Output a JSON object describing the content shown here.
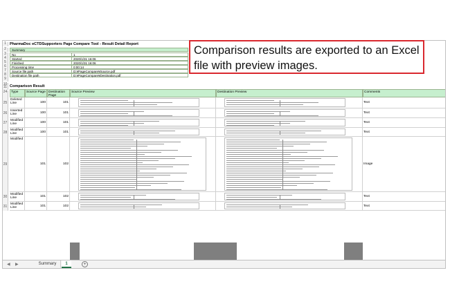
{
  "report": {
    "title": "PharmaDoc eCTDSupporters Page Compare Tool - Result Detail Report",
    "summary_header": "Summary",
    "summary_rows": [
      {
        "key": "No",
        "value": "1"
      },
      {
        "key": "Started",
        "value": "2020/1/31 16:06"
      },
      {
        "key": "Finished",
        "value": "2020/1/31 16:06"
      },
      {
        "key": "Processing time",
        "value": "0:00:14"
      },
      {
        "key": "Source file path",
        "value": "D:¥PageCompare¥Source.pdf"
      },
      {
        "key": "Destination file path",
        "value": "D:¥PageCompare¥Destination.pdf"
      }
    ],
    "result_title": "Comparison Result",
    "columns": [
      "Type",
      "Source Page",
      "Destination Page",
      "Source Preview",
      "Destination Preview",
      "Comments"
    ],
    "rows": [
      {
        "num": "25",
        "type": "Deleted Line",
        "src": "100",
        "dst": "101",
        "comment": "Text"
      },
      {
        "num": "26",
        "type": "Inserted Line",
        "src": "100",
        "dst": "101",
        "comment": "Text"
      },
      {
        "num": "27",
        "type": "Modified Line",
        "src": "100",
        "dst": "101",
        "comment": "Text"
      },
      {
        "num": "28",
        "type": "Modified Line",
        "src": "100",
        "dst": "101",
        "comment": "Text"
      },
      {
        "num": "29",
        "type": "Modified",
        "src": "101",
        "dst": "102",
        "comment": "Image"
      },
      {
        "num": "30",
        "type": "Modified Line",
        "src": "101",
        "dst": "102",
        "comment": "Text"
      },
      {
        "num": "31",
        "type": "Modified Line",
        "src": "101",
        "dst": "102",
        "comment": "Text"
      }
    ]
  },
  "sheet_tabs": {
    "summary": "Summary",
    "detail": "1",
    "add": "+"
  },
  "callout": "Comparison results are exported to an Excel file with preview images."
}
